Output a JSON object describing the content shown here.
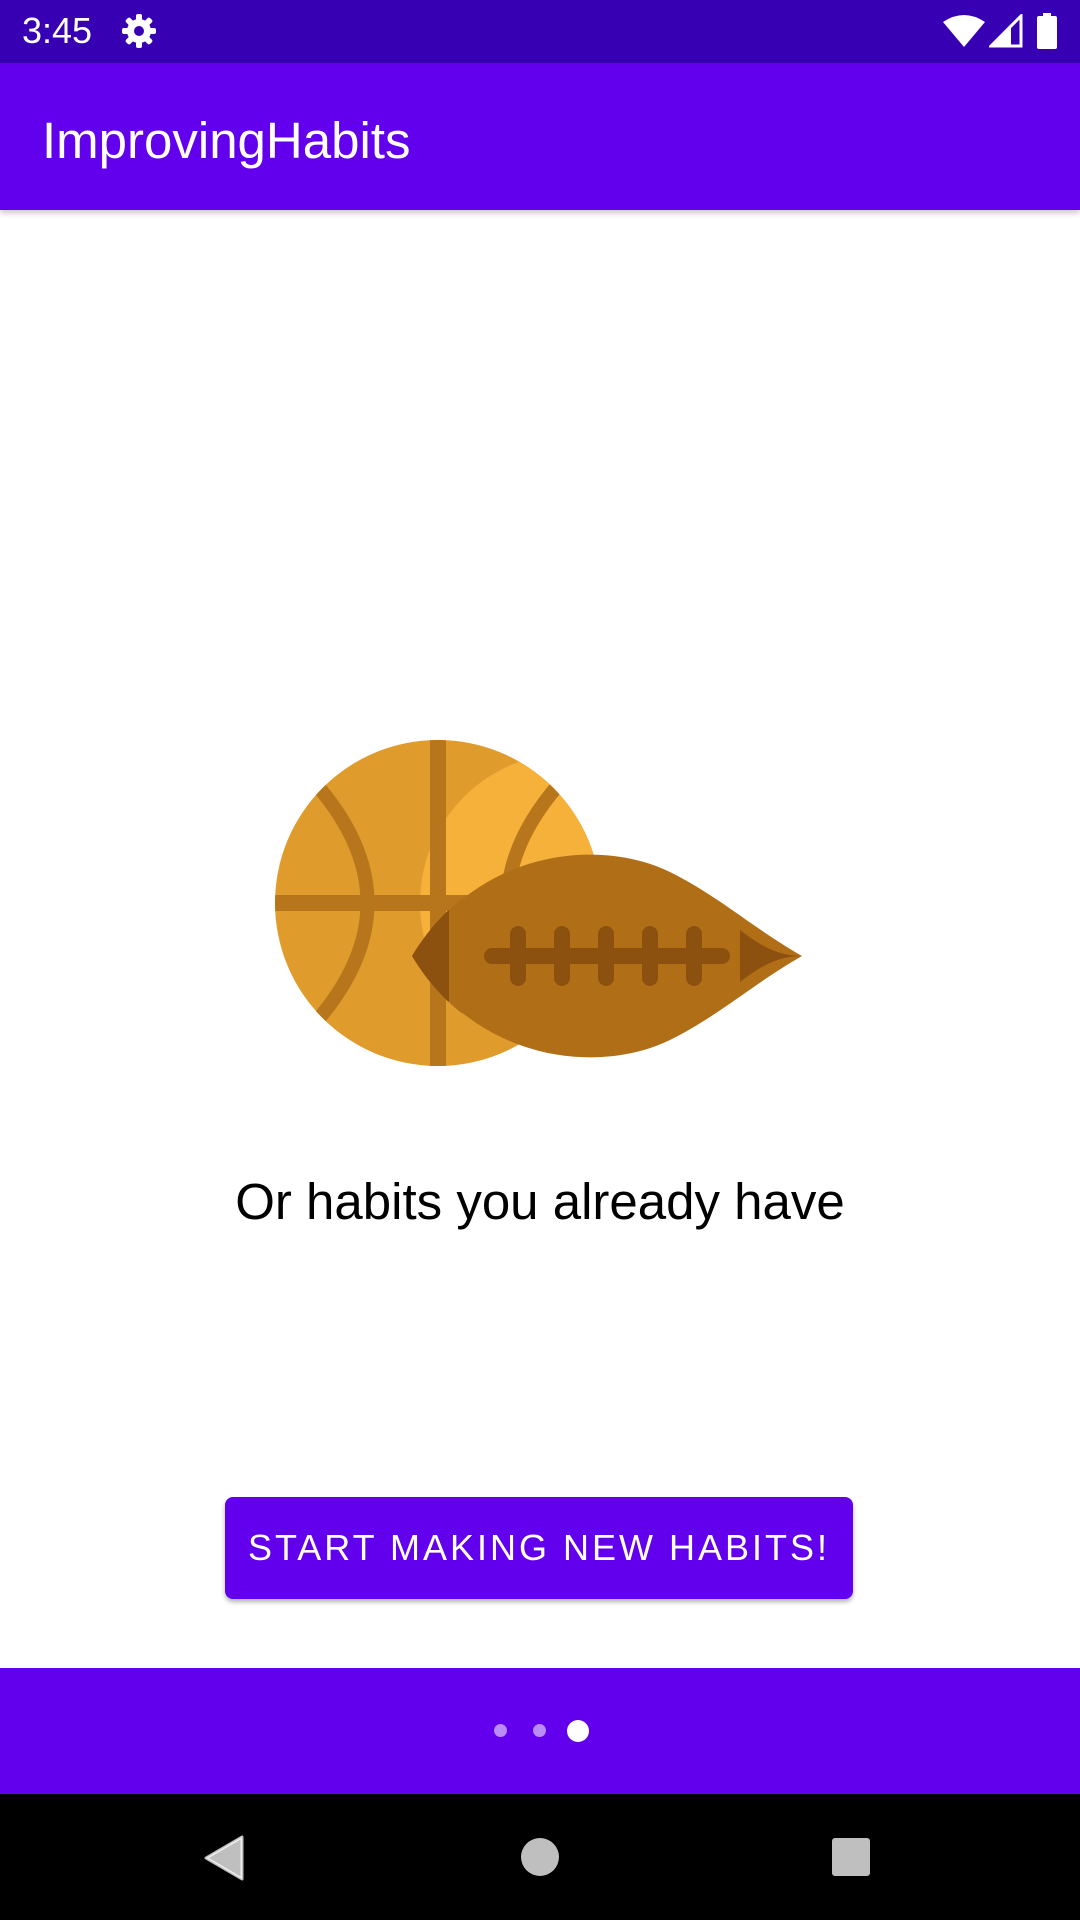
{
  "status_bar": {
    "time": "3:45",
    "icons": [
      "settings-gear-icon",
      "wifi-icon",
      "cell-signal-icon",
      "battery-icon"
    ]
  },
  "app_bar": {
    "title": "ImprovingHabits"
  },
  "onboarding": {
    "illustration": "basketball-and-football-illustration",
    "caption": "Or habits you already have",
    "cta_label": "START MAKING NEW HABITS!",
    "page_indicator": {
      "current_page": 3,
      "total_pages": 3
    }
  },
  "navigation_bar": {
    "icons": [
      "back-icon",
      "home-icon",
      "recents-icon"
    ]
  },
  "colors": {
    "status_bar": "#3700b3",
    "primary": "#6200ee",
    "background": "#ffffff",
    "basketball_light": "#f6b13a",
    "basketball_dark": "#e09b2d",
    "football": "#b06f17",
    "football_dark": "#8c500f"
  }
}
